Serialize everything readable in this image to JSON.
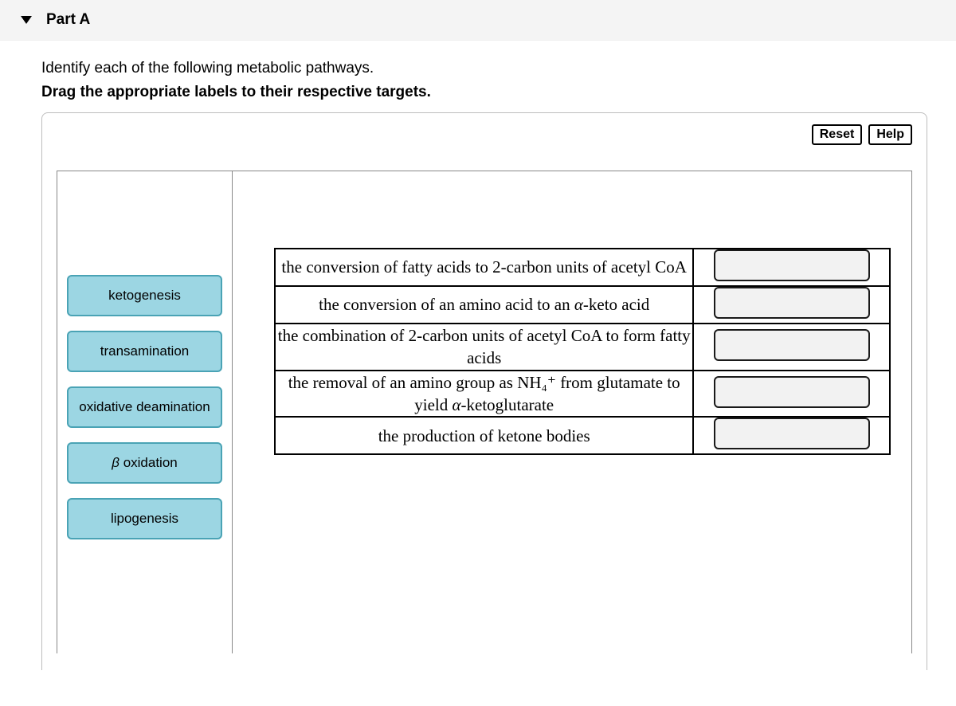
{
  "header": {
    "part_label": "Part A"
  },
  "instructions": {
    "line1": "Identify each of the following metabolic pathways.",
    "line2": "Drag the appropriate labels to their respective targets."
  },
  "buttons": {
    "reset": "Reset",
    "help": "Help"
  },
  "labels": [
    {
      "text": "ketogenesis"
    },
    {
      "text": "transamination"
    },
    {
      "text": "oxidative deamination"
    },
    {
      "prefix": "β",
      "suffix": " oxidation"
    },
    {
      "text": "lipogenesis"
    }
  ],
  "rows": [
    {
      "desc_plain": "the conversion of fatty acids to 2-carbon units of acetyl CoA"
    },
    {
      "desc_pre": "the conversion of an amino acid to an ",
      "desc_alpha": "α",
      "desc_post": "-keto acid"
    },
    {
      "desc_plain": "the combination of 2-carbon units of acetyl CoA to form fatty acids"
    },
    {
      "desc_pre": "the removal of an amino group as NH₄⁺ from glutamate to yield ",
      "desc_alpha": "α",
      "desc_post": "-ketoglutarate"
    },
    {
      "desc_plain": "the production of ketone bodies"
    }
  ]
}
